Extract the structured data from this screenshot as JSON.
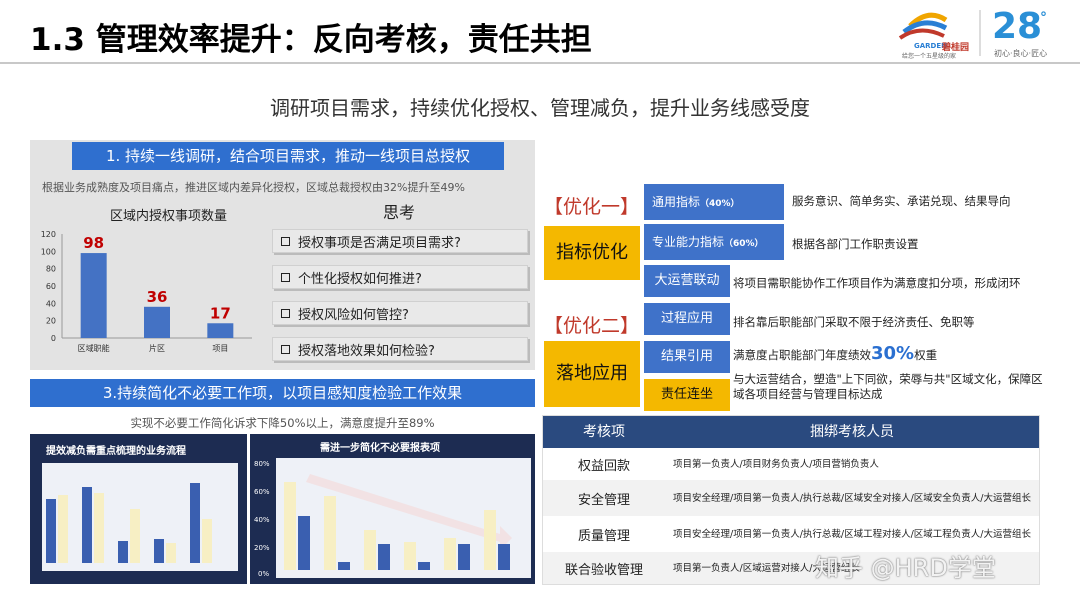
{
  "title": "1.3 管理效率提升：反向考核，责任共担",
  "logo": {
    "brand": "碧桂园",
    "brand_en": "GARDEN",
    "slogan": "给您一个五星级的家",
    "anniversary": "28",
    "anniversary_sub": "初心·良心·匠心"
  },
  "subtitle": "调研项目需求，持续优化授权、管理减负，提升业务线感受度",
  "section1": {
    "header": "1. 持续一线调研，结合项目需求，推动一线项目总授权",
    "note": "根据业务成熟度及项目痛点，推进区域内差异化授权，区域总裁授权由32%提升至49%",
    "chart_title": "区域内授权事项数量",
    "think_title": "思考",
    "questions": [
      "授权事项是否满足项目需求?",
      "个性化授权如何推进?",
      "授权风险如何管控?",
      "授权落地效果如何检验?"
    ]
  },
  "chart_data": [
    {
      "type": "bar",
      "title": "区域内授权事项数量",
      "categories": [
        "区域职能",
        "片区",
        "项目"
      ],
      "values": [
        98,
        36,
        17
      ],
      "ylim": [
        0,
        120
      ],
      "yticks": [
        "0",
        "20",
        "40",
        "60",
        "80",
        "100",
        "120"
      ],
      "color": "#4472c4",
      "label_color": "#c00000"
    }
  ],
  "section3": {
    "header": "3.持续简化不必要工作项，以项目感知度检验工作效果",
    "note": "实现不必要工作简化诉求下降50%以上，满意度提升至89%",
    "img1_title": "提效减负需重点梳理的业务流程",
    "img2_title": "需进一步简化不必要报表项",
    "img2_yticks": [
      "80%",
      "60%",
      "40%",
      "20%",
      "0%"
    ]
  },
  "section2": {
    "opt1_label": "【优化一】",
    "opt1_box": "指标优化",
    "opt1_items": [
      {
        "name": "通用指标",
        "pct": "（40%）",
        "desc": "服务意识、简单务实、承诺兑现、结果导向"
      },
      {
        "name": "专业能力指标",
        "pct": "（60%）",
        "desc": "根据各部门工作职责设置"
      }
    ],
    "opt2_label": "【优化二】",
    "opt2_box": "落地应用",
    "opt2_items": [
      {
        "name": "大运营联动",
        "desc": "将项目需职能协作工作项目作为满意度扣分项，形成闭环"
      },
      {
        "name": "过程应用",
        "desc": "排名靠后职能部门采取不限于经济责任、免职等"
      },
      {
        "name": "结果引用",
        "desc_pre": "满意度占职能部门年度绩效",
        "desc_big": "30%",
        "desc_post": "权重"
      },
      {
        "name": "责任连坐",
        "desc": "与大运营结合，塑造\"上下同欲，荣辱与共\"区域文化，保障区域各项目经营与管理目标达成"
      }
    ]
  },
  "table": {
    "headers": [
      "考核项",
      "捆绑考核人员"
    ],
    "rows": [
      [
        "权益回款",
        "项目第一负责人/项目财务负责人/项目营销负责人"
      ],
      [
        "安全管理",
        "项目安全经理/项目第一负责人/执行总裁/区域安全对接人/区域安全负责人/大运营组长"
      ],
      [
        "质量管理",
        "项目安全经理/项目第一负责人/执行总裁/区域工程对接人/区域工程负责人/大运营组长"
      ],
      [
        "联合验收管理",
        "项目第一负责人/区域运营对接人/大运营组长"
      ]
    ]
  },
  "watermark": "知乎 @HRD学堂"
}
